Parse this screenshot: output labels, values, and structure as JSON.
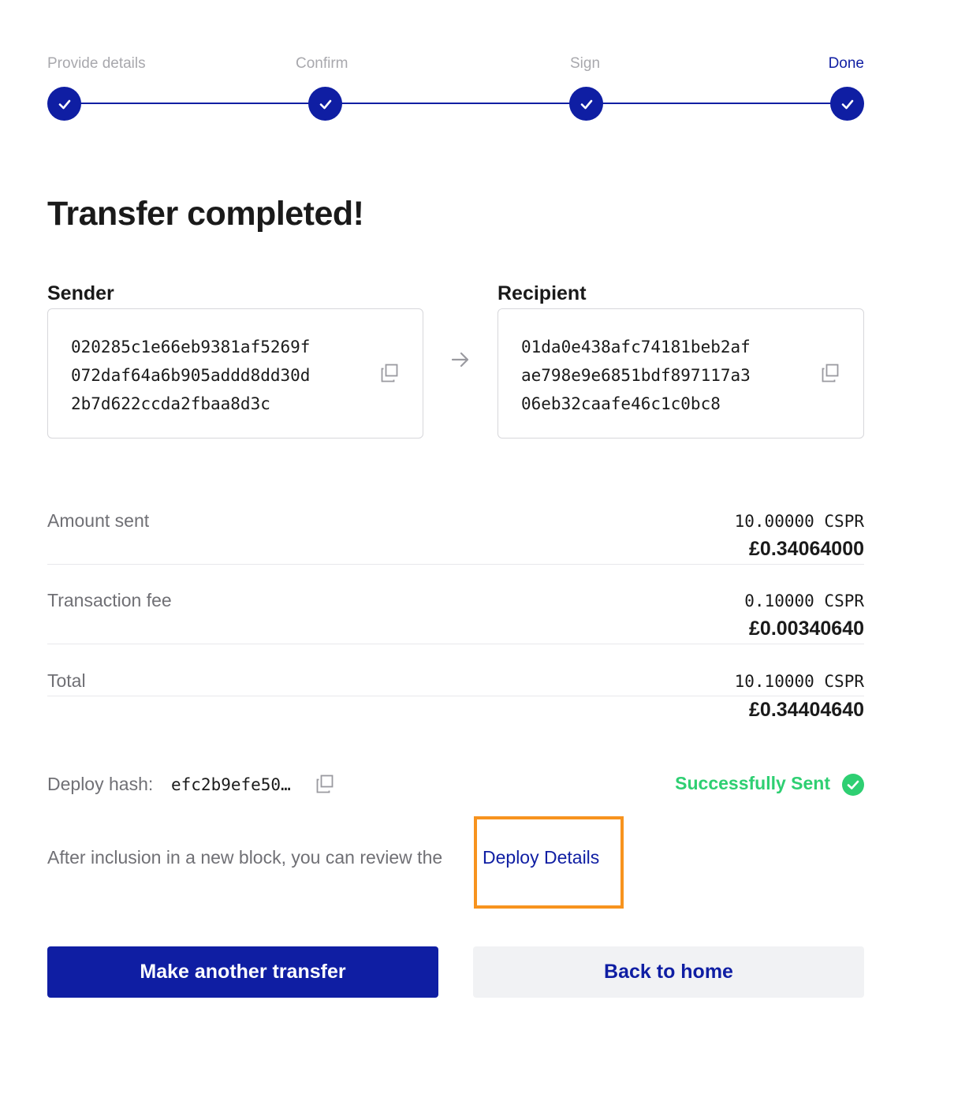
{
  "stepper": {
    "steps": [
      {
        "label": "Provide details",
        "state": "completed"
      },
      {
        "label": "Confirm",
        "state": "completed"
      },
      {
        "label": "Sign",
        "state": "completed"
      },
      {
        "label": "Done",
        "state": "current"
      }
    ]
  },
  "page_title": "Transfer completed!",
  "sender": {
    "label": "Sender",
    "address_lines": [
      "020285c1e66eb9381af5269f",
      "072daf64a6b905addd8dd30d",
      "2b7d622ccda2fbaa8d3c"
    ]
  },
  "recipient": {
    "label": "Recipient",
    "address_lines": [
      "01da0e438afc74181beb2af",
      "ae798e9e6851bdf897117a3",
      "06eb32caafe46c1c0bc8"
    ]
  },
  "summary": {
    "amount_sent": {
      "label": "Amount sent",
      "cspr": "10.00000 CSPR",
      "fiat": "£0.34064000"
    },
    "transaction_fee": {
      "label": "Transaction fee",
      "cspr": "0.10000 CSPR",
      "fiat": "£0.00340640"
    },
    "total": {
      "label": "Total",
      "cspr": "10.10000 CSPR",
      "fiat": "£0.34404640"
    }
  },
  "deploy": {
    "hash_label": "Deploy hash:",
    "hash_value": "efc2b9efe50…",
    "status": "Successfully Sent",
    "note": "After inclusion in a new block, you can review the",
    "link_label": "Deploy Details"
  },
  "actions": {
    "primary_label": "Make another transfer",
    "secondary_label": "Back to home"
  },
  "colors": {
    "accent": "#0f1ea3",
    "success": "#2ecf72",
    "highlight": "#f7931e"
  }
}
